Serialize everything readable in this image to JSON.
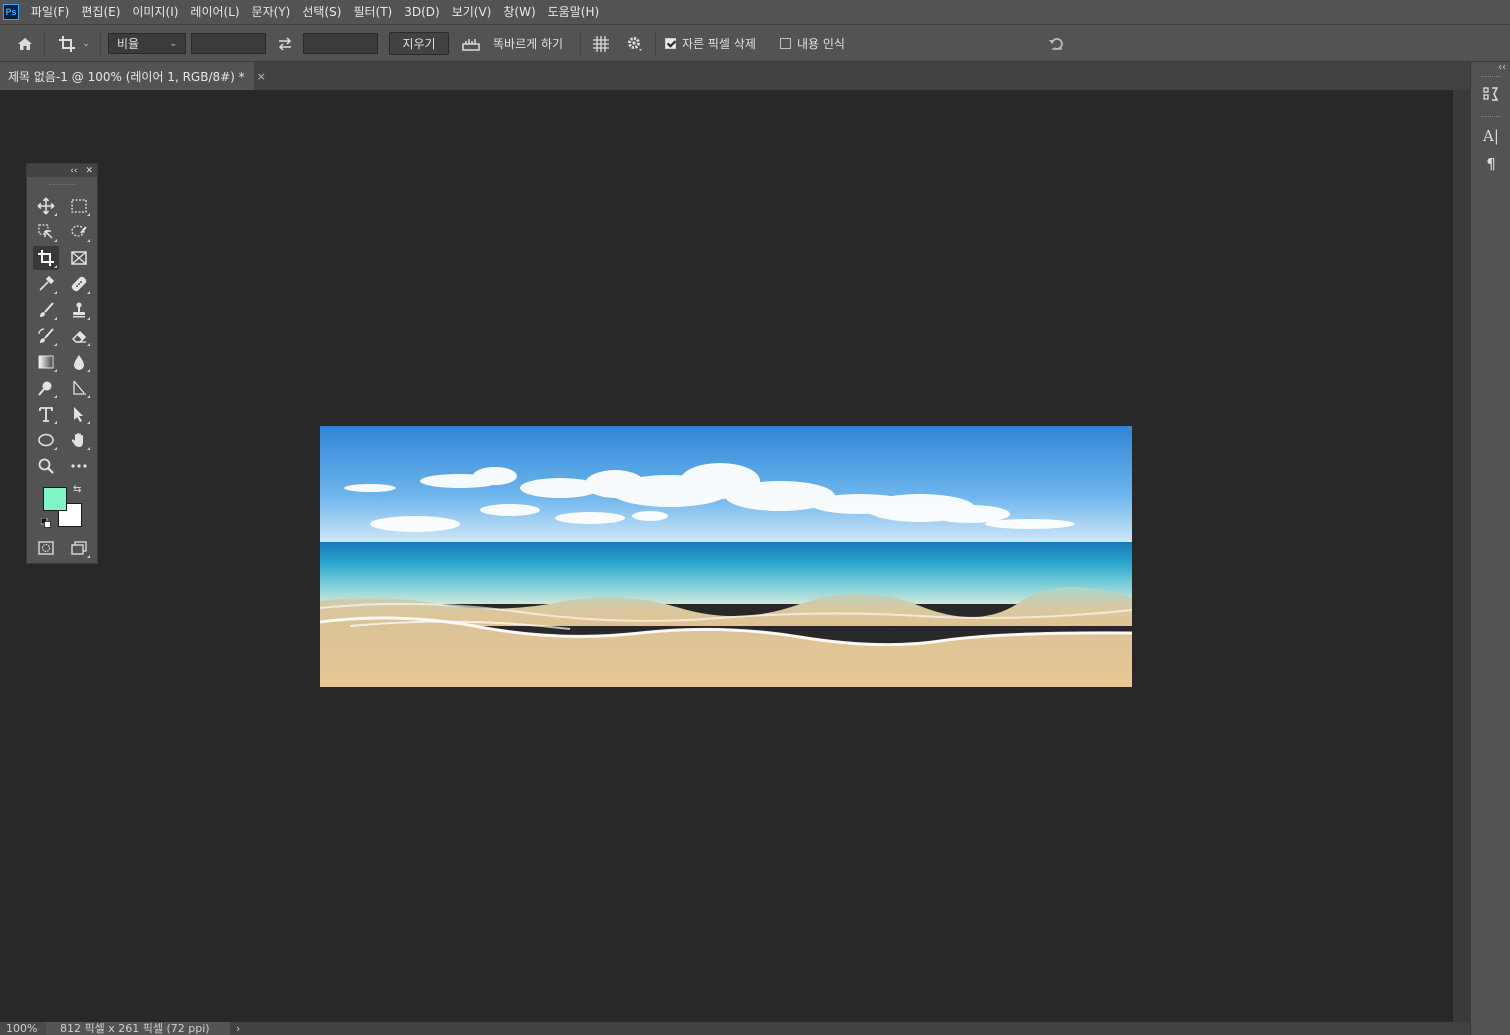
{
  "app": {
    "logo": "Ps"
  },
  "menu": [
    "파일(F)",
    "편집(E)",
    "이미지(I)",
    "레이어(L)",
    "문자(Y)",
    "선택(S)",
    "필터(T)",
    "3D(D)",
    "보기(V)",
    "창(W)",
    "도움말(H)"
  ],
  "options": {
    "ratio_select": "비율",
    "clear_button": "지우기",
    "straighten_label": "똑바르게 하기",
    "delete_cropped_label": "자른 픽셀 삭제",
    "delete_cropped_checked": true,
    "content_aware_label": "내용 인식",
    "content_aware_checked": false
  },
  "document": {
    "tab_title": "제목 없음-1 @ 100% (레이어 1, RGB/8#) *",
    "close_glyph": "×"
  },
  "colors": {
    "foreground": "#7ff5c6",
    "background": "#ffffff",
    "ui_panel": "#535353",
    "workspace": "#282828"
  },
  "status": {
    "zoom": "100%",
    "doc_info": "812 픽셀 x 261 픽셀 (72 ppi)",
    "arrow": "›"
  }
}
